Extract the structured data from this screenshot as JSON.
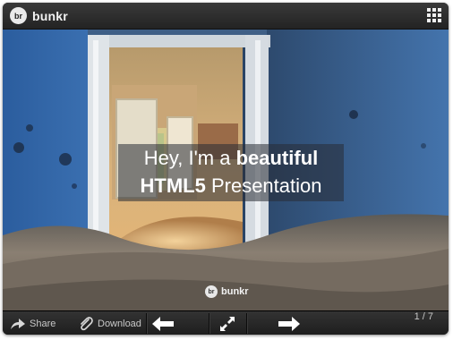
{
  "header": {
    "logo_badge": "br",
    "logo_text": "bunkr",
    "menu_icon": "grid-menu-icon"
  },
  "slide": {
    "caption_prefix": "Hey, I'm a ",
    "caption_bold1": "beautiful",
    "caption_bold2": "HTML5",
    "caption_suffix": " Presentation",
    "watermark_badge": "br",
    "watermark_text": "bunkr"
  },
  "toolbar": {
    "share_label": "Share",
    "download_label": "Download",
    "prev_icon": "arrow-left-icon",
    "fullscreen_icon": "fullscreen-icon",
    "next_icon": "arrow-right-icon",
    "page_counter": "1 / 7"
  }
}
